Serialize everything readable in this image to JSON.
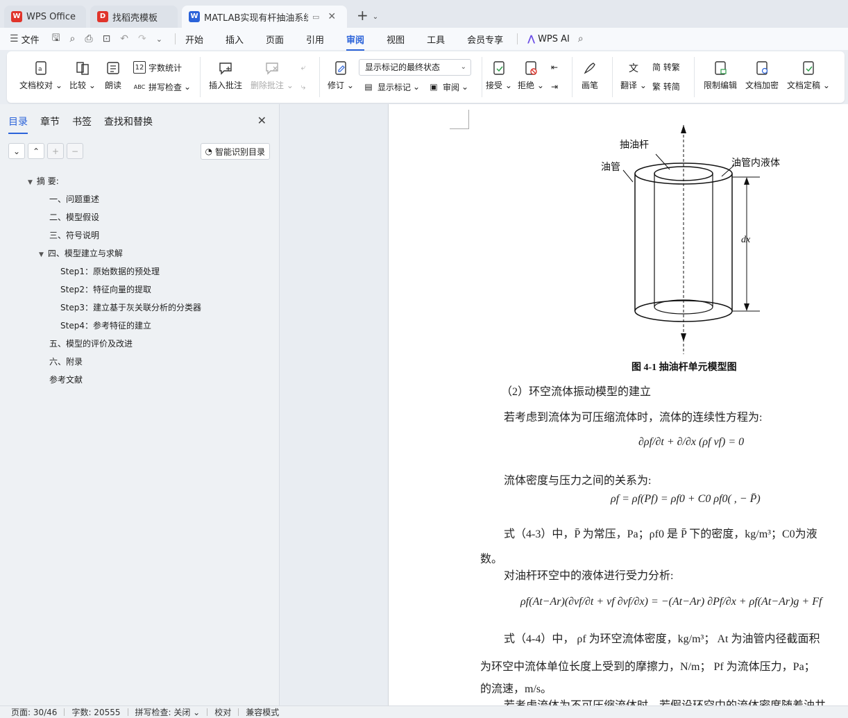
{
  "tabs": [
    {
      "label": "WPS Office",
      "icon": "wps-logo-icon",
      "color": "#e0342b"
    },
    {
      "label": "找稻壳模板",
      "icon": "docer-icon",
      "color": "#e0342b"
    },
    {
      "label": "MATLAB实现有杆抽油系统的",
      "icon": "word-doc-icon",
      "color": "#2b63d9"
    }
  ],
  "menu": {
    "file": "文件",
    "items": [
      "开始",
      "插入",
      "页面",
      "引用",
      "审阅",
      "视图",
      "工具",
      "会员专享"
    ],
    "active": "审阅",
    "ai": "WPS AI"
  },
  "ribbon": {
    "proofread": "文档校对",
    "compare": "比较",
    "read_aloud": "朗读",
    "word_count": "字数统计",
    "spell_check": "拼写检查",
    "insert_comment": "插入批注",
    "delete_comment": "删除批注",
    "track": "修订",
    "markup_state": "显示标记的最终状态",
    "show_markup": "显示标记",
    "review": "审阅",
    "accept": "接受",
    "reject": "拒绝",
    "ink": "画笔",
    "translate": "翻译",
    "to_traditional": "简 转繁",
    "to_simplified": "繁 转简",
    "restrict_edit": "限制编辑",
    "encrypt": "文档加密",
    "finalize": "文档定稿"
  },
  "left_panel": {
    "tabs": [
      "目录",
      "章节",
      "书签",
      "查找和替换"
    ],
    "active_tab": "目录",
    "smart_toc": "智能识别目录",
    "toc": [
      {
        "label": "摘 要:",
        "level": 0,
        "expanded": true
      },
      {
        "label": "一、问题重述",
        "level": 1
      },
      {
        "label": "二、模型假设",
        "level": 1
      },
      {
        "label": "三、符号说明",
        "level": 1
      },
      {
        "label": "四、模型建立与求解",
        "level": 1,
        "expanded": true
      },
      {
        "label": "Step1：原始数据的预处理",
        "level": 2
      },
      {
        "label": "Step2：特征向量的提取",
        "level": 2
      },
      {
        "label": "Step3：建立基于灰关联分析的分类器",
        "level": 2
      },
      {
        "label": "Step4：参考特征的建立",
        "level": 2
      },
      {
        "label": "五、模型的评价及改进",
        "level": 1
      },
      {
        "label": "六、附录",
        "level": 1
      },
      {
        "label": "参考文献",
        "level": 1
      }
    ]
  },
  "document": {
    "figure_labels": {
      "rod": "抽油杆",
      "tubing": "油管",
      "liquid": "油管内液体",
      "dx": "dx"
    },
    "caption": "图 4-1  抽油杆单元模型图",
    "section": "（2）环空流体振动模型的建立",
    "p1": "若考虑到流体为可压缩流体时，流体的连续性方程为:",
    "eq1": "∂ρf/∂t + ∂/∂x (ρf vf) = 0",
    "p2": "流体密度与压力之间的关系为:",
    "eq2": "ρf = ρf(Pf) = ρf0 + C0 ρf0( , − P̄)",
    "p3": "式（4-3）中，P̄ 为常压，Pa；ρf0 是 P̄ 下的密度，kg/m³；C0为液",
    "p3b": "数。",
    "p4": "对油杆环空中的液体进行受力分析:",
    "eq3": "ρf(At−Ar)(∂vf/∂t + vf ∂vf/∂x) = −(At−Ar) ∂Pf/∂x + ρf(At−Ar)g + Ff",
    "p5": "式（4-4）中，  ρf 为环空流体密度，kg/m³；  At 为油管内径截面积",
    "p6": "为环空中流体单位长度上受到的摩擦力，N/m；  Pf 为流体压力，Pa；",
    "p7": "的流速，m/s。",
    "p8": "若考虑流体为不可压缩流体时，若假设环空中的流体密度随着油井"
  },
  "status": {
    "page": "页面: 30/46",
    "words": "字数: 20555",
    "spell": "拼写检查: 关闭",
    "proof": "校对",
    "compat": "兼容模式"
  }
}
